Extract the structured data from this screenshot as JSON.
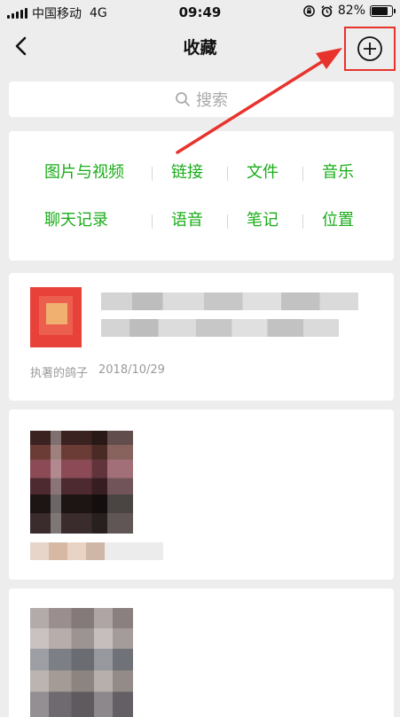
{
  "status_bar": {
    "carrier": "中国移动",
    "network": "4G",
    "time": "09:49",
    "battery": "82%",
    "battery_level": 0.82,
    "icons": [
      "signal-icon",
      "lock-rotation-icon",
      "alarm-icon",
      "battery-icon"
    ]
  },
  "nav": {
    "title": "收藏",
    "icons": [
      "back-chevron-icon",
      "add-circle-icon"
    ]
  },
  "search": {
    "placeholder": "搜索",
    "icon": "search-icon"
  },
  "categories": [
    [
      "图片与视频",
      "链接",
      "文件",
      "音乐"
    ],
    [
      "聊天记录",
      "语音",
      "笔记",
      "位置"
    ]
  ],
  "favorites": [
    {
      "source": "执著的鸽子",
      "date": "2018/10/29"
    }
  ],
  "colors": {
    "accent_green": "#1aad19",
    "annotation_red": "#e8332d",
    "background": "#ededed"
  }
}
